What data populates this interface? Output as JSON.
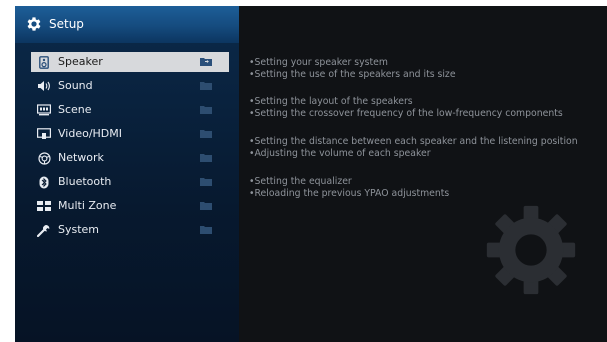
{
  "header": {
    "title": "Setup",
    "icon": "gear-icon"
  },
  "menu": {
    "items": [
      {
        "label": "Speaker",
        "icon": "speaker-icon",
        "selected": true
      },
      {
        "label": "Sound",
        "icon": "sound-icon",
        "selected": false
      },
      {
        "label": "Scene",
        "icon": "scene-icon",
        "selected": false
      },
      {
        "label": "Video/HDMI",
        "icon": "video-hdmi-icon",
        "selected": false
      },
      {
        "label": "Network",
        "icon": "network-icon",
        "selected": false
      },
      {
        "label": "Bluetooth",
        "icon": "bluetooth-icon",
        "selected": false
      },
      {
        "label": "Multi Zone",
        "icon": "multi-zone-icon",
        "selected": false
      },
      {
        "label": "System",
        "icon": "wrench-icon",
        "selected": false
      }
    ]
  },
  "descriptions": [
    "Setting your speaker system",
    "Setting the use of the speakers and its size",
    "Setting the layout of the speakers",
    "Setting the crossover frequency of the low-frequency components",
    "Setting the distance between each speaker and the listening position",
    "Adjusting the volume of each speaker",
    "Setting the equalizer",
    "Reloading the previous YPAO adjustments"
  ],
  "bullet": "•",
  "colors": {
    "header": "#1d5e98",
    "selected_bg": "#d7d9dc",
    "text": "#e8ecf2",
    "desc_text": "#8e939a"
  }
}
